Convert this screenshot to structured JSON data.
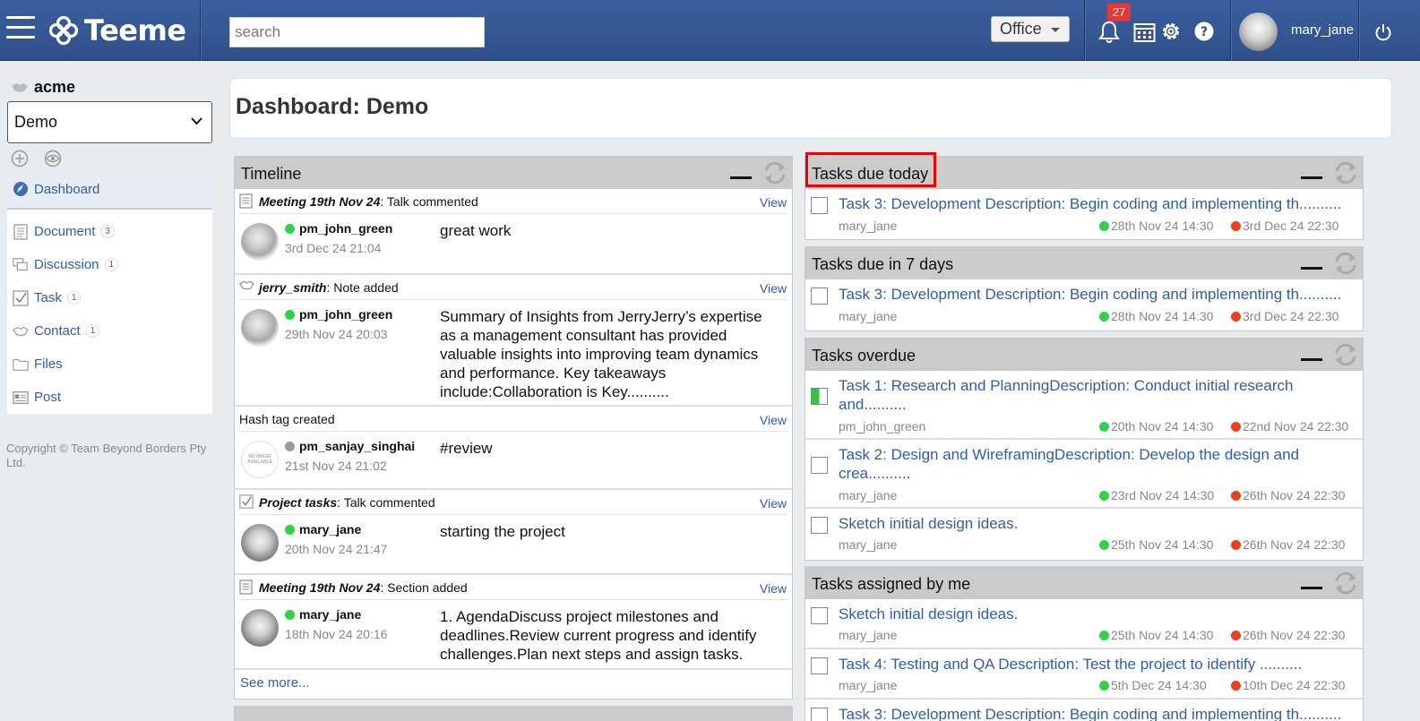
{
  "app": {
    "logo_text": "Teeme",
    "search_placeholder": "search",
    "workspace_select": "Office",
    "notification_count": "27",
    "username": "mary_jane",
    "colors": {
      "topbar": "#2f4f89",
      "link": "#2f5ea8",
      "highlight": "#ee0000",
      "online": "#35d04a",
      "due": "#e8421a"
    }
  },
  "sidebar": {
    "org_name": "acme",
    "dashboard_select": "Demo",
    "items": [
      {
        "label": "Dashboard",
        "icon": "dashboard-icon"
      },
      {
        "label": "Document",
        "count": "3",
        "icon": "document-icon"
      },
      {
        "label": "Discussion",
        "count": "1",
        "icon": "discussion-icon"
      },
      {
        "label": "Task",
        "count": "1",
        "icon": "task-icon"
      },
      {
        "label": "Contact",
        "count": "1",
        "icon": "contact-icon"
      },
      {
        "label": "Files",
        "icon": "folder-icon"
      },
      {
        "label": "Post",
        "icon": "post-icon"
      }
    ],
    "copyright": "Copyright © Team Beyond Borders Pty Ltd."
  },
  "page": {
    "title": "Dashboard: Demo"
  },
  "timeline": {
    "title": "Timeline",
    "view_label": "View",
    "see_more": "See more...",
    "entries": [
      {
        "source": "Meeting 19th Nov 24",
        "action": ": Talk commented",
        "user": "pm_john_green",
        "time": "3rd Dec 24 21:04",
        "text": "great work"
      },
      {
        "source": "jerry_smith",
        "action": ": Note added",
        "user": "pm_john_green",
        "time": "29th Nov 24 20:03",
        "text": "Summary of Insights from JerryJerry’s expertise as a management consultant has provided valuable insights into improving team dynamics and performance. Key takeaways include:Collaboration is Key.........."
      },
      {
        "source": "",
        "action": "Hash tag created",
        "user": "pm_sanjay_singhai",
        "time": "21st Nov 24 21:02",
        "text": "#review",
        "no_image": "NO IMAGE AVAILABLE"
      },
      {
        "source": "Project tasks",
        "action": ": Talk commented",
        "user": "mary_jane",
        "time": "20th Nov 24 21:47",
        "text": "starting the project"
      },
      {
        "source": "Meeting 19th Nov 24",
        "action": ": Section added",
        "user": "mary_jane",
        "time": "18th Nov 24 20:16",
        "text": "1. AgendaDiscuss project milestones and deadlines.Review current progress and identify challenges.Plan next steps and assign tasks."
      }
    ]
  },
  "tasks_due_today": {
    "title": "Tasks due today",
    "tasks": [
      {
        "name": "Task 3: Development Description: Begin coding and implementing th..........",
        "user": "mary_jane",
        "start": "28th Nov 24 14:30",
        "end": "3rd Dec 24 22:30"
      }
    ]
  },
  "tasks_due_7": {
    "title": "Tasks due in 7 days",
    "tasks": [
      {
        "name": "Task 3: Development Description: Begin coding and implementing th..........",
        "user": "mary_jane",
        "start": "28th Nov 24 14:30",
        "end": "3rd Dec 24 22:30"
      }
    ]
  },
  "tasks_overdue": {
    "title": "Tasks overdue",
    "tasks": [
      {
        "name": "Task 1: Research and PlanningDescription: Conduct initial research and..........",
        "user": "pm_john_green",
        "start": "20th Nov 24 14:30",
        "end": "22nd Nov 24 22:30",
        "progress": 0.5
      },
      {
        "name": "Task 2: Design and WireframingDescription: Develop the design and crea..........",
        "user": "mary_jane",
        "start": "23rd Nov 24 14:30",
        "end": "26th Nov 24 22:30"
      },
      {
        "name": "Sketch initial design ideas.",
        "user": "mary_jane",
        "start": "25th Nov 24 14:30",
        "end": "26th Nov 24 22:30"
      }
    ]
  },
  "tasks_assigned": {
    "title": "Tasks assigned by me",
    "tasks": [
      {
        "name": "Sketch initial design ideas.",
        "user": "mary_jane",
        "start": "25th Nov 24 14:30",
        "end": "26th Nov 24 22:30"
      },
      {
        "name": "Task 4: Testing and QA Description: Test the project to identify ..........",
        "user": "mary_jane",
        "start": "5th Dec 24 14:30",
        "end": "10th Dec 24 22:30"
      },
      {
        "name": "Task 3: Development Description: Begin coding and implementing th.........."
      }
    ]
  }
}
